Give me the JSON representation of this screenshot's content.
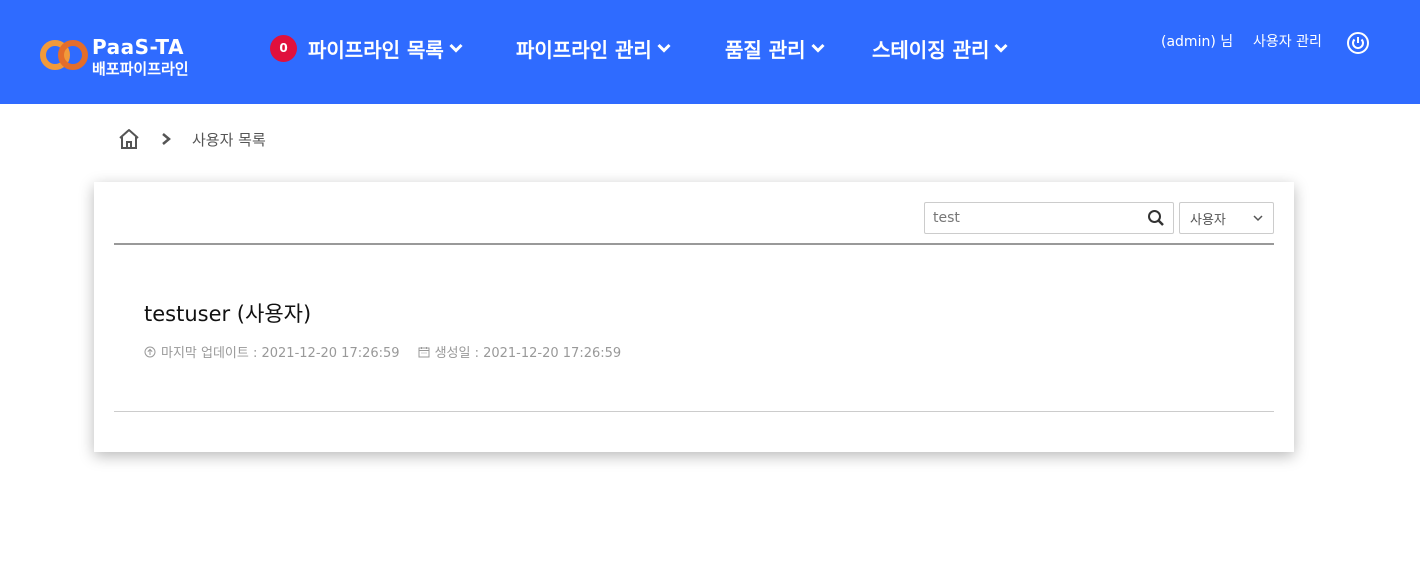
{
  "brand": {
    "title": "PaaS-TA",
    "subtitle": "배포파이프라인",
    "ring_colors": [
      "#f29a3a",
      "#e46d2a"
    ]
  },
  "nav": {
    "badge_count": "0",
    "items": [
      {
        "label": "파이프라인 목록"
      },
      {
        "label": "파이프라인 관리"
      },
      {
        "label": "품질 관리"
      },
      {
        "label": "스테이징 관리"
      }
    ]
  },
  "header_right": {
    "user": "(admin) 님",
    "user_management": "사용자 관리",
    "power_icon": "power-icon"
  },
  "breadcrumb": {
    "home_icon": "home-icon",
    "current": "사용자 목록"
  },
  "search": {
    "value": "test",
    "filter_selected": "사용자"
  },
  "users": [
    {
      "title": "testuser (사용자)",
      "updated": "마지막 업데이트 : 2021-12-20 17:26:59",
      "created": "생성일 : 2021-12-20 17:26:59"
    }
  ],
  "colors": {
    "header_bg": "#2f6bff",
    "badge_bg": "#e0103c"
  }
}
